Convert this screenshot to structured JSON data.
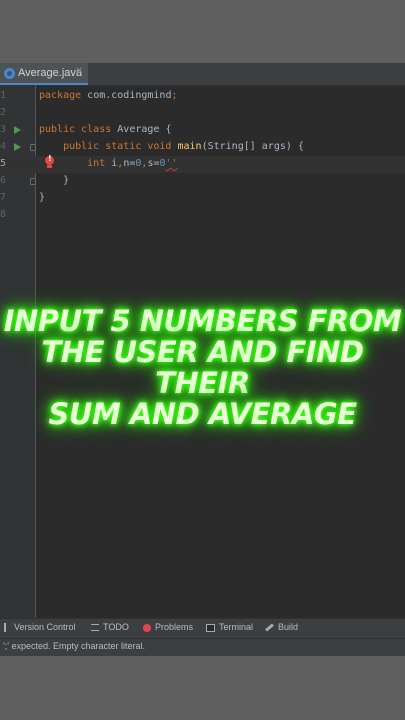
{
  "editor": {
    "tab": {
      "label": "Average.java",
      "icon": "java-class-icon"
    },
    "lines": [
      {
        "number": "1",
        "tokens": [
          {
            "t": "package ",
            "c": "kw"
          },
          {
            "t": "com.codingmind",
            "c": ""
          },
          {
            "t": ";",
            "c": "kw"
          }
        ]
      },
      {
        "number": "2",
        "tokens": []
      },
      {
        "number": "3",
        "tokens": [
          {
            "t": "public class ",
            "c": "kw"
          },
          {
            "t": "Average {",
            "c": ""
          }
        ]
      },
      {
        "number": "4",
        "tokens": [
          {
            "t": "    public static void ",
            "c": "kw"
          },
          {
            "t": "main",
            "c": "fn"
          },
          {
            "t": "(String[] args) {",
            "c": ""
          }
        ]
      },
      {
        "number": "5",
        "tokens": [
          {
            "t": "        int ",
            "c": "kw"
          },
          {
            "t": "i",
            "c": ""
          },
          {
            "t": ",",
            "c": "kw"
          },
          {
            "t": "n",
            "c": ""
          },
          {
            "t": "=",
            "c": ""
          },
          {
            "t": "0",
            "c": "num"
          },
          {
            "t": ",",
            "c": "kw"
          },
          {
            "t": "s",
            "c": ""
          },
          {
            "t": "=",
            "c": ""
          },
          {
            "t": "0",
            "c": "num"
          },
          {
            "t": "''",
            "c": "err"
          }
        ]
      },
      {
        "number": "6",
        "tokens": [
          {
            "t": "    }",
            "c": ""
          }
        ]
      },
      {
        "number": "7",
        "tokens": [
          {
            "t": "}",
            "c": ""
          }
        ]
      },
      {
        "number": "8",
        "tokens": []
      }
    ]
  },
  "caption": {
    "line1": "Input 5 Numbers from",
    "line2": "the user and find their",
    "line3": "sum and average"
  },
  "tool_windows": {
    "version_control": "Version Control",
    "todo": "TODO",
    "problems": "Problems",
    "terminal": "Terminal",
    "build": "Build"
  },
  "status": {
    "message": "';' expected. Empty character literal."
  },
  "colors": {
    "caption_glow": "#39ff14",
    "keyword": "#cc7832",
    "method": "#ffc66d",
    "number": "#6897bb"
  }
}
